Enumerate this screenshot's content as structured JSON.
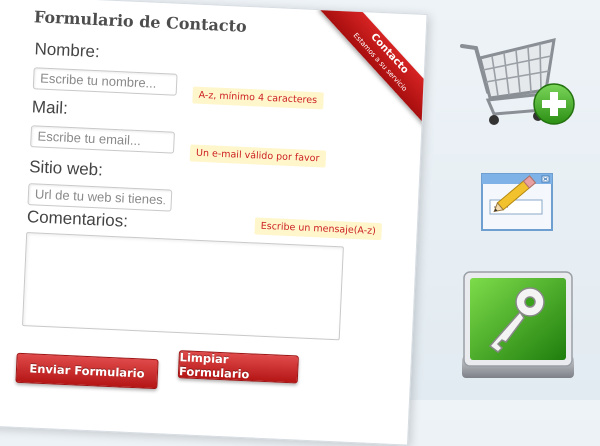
{
  "form": {
    "title": "Formulario de Contacto",
    "ribbon": {
      "line1": "Contacto",
      "line2": "Estamos a su servicio"
    },
    "name": {
      "label": "Nombre:",
      "placeholder": "Escribe tu nombre...",
      "hint": "A-z, mínimo 4 caracteres"
    },
    "email": {
      "label": "Mail:",
      "placeholder": "Escribe tu email...",
      "hint": "Un e-mail válido por favor"
    },
    "website": {
      "label": "Sitio web:",
      "placeholder": "Url de tu web si tienes..."
    },
    "comments": {
      "label": "Comentarios:",
      "hint": "Escribe un mensaje(A-z)"
    },
    "buttons": {
      "submit": "Enviar Formulario",
      "reset": "Limpiar Formulario"
    }
  },
  "icons": {
    "cart": "shopping-cart-add-icon",
    "edit": "edit-window-pencil-icon",
    "key": "green-key-icon"
  },
  "colors": {
    "accent_red": "#c0181a",
    "hint_bg": "#fff6cc",
    "hint_text": "#cc1f1f",
    "key_green": "#3aa11d"
  }
}
